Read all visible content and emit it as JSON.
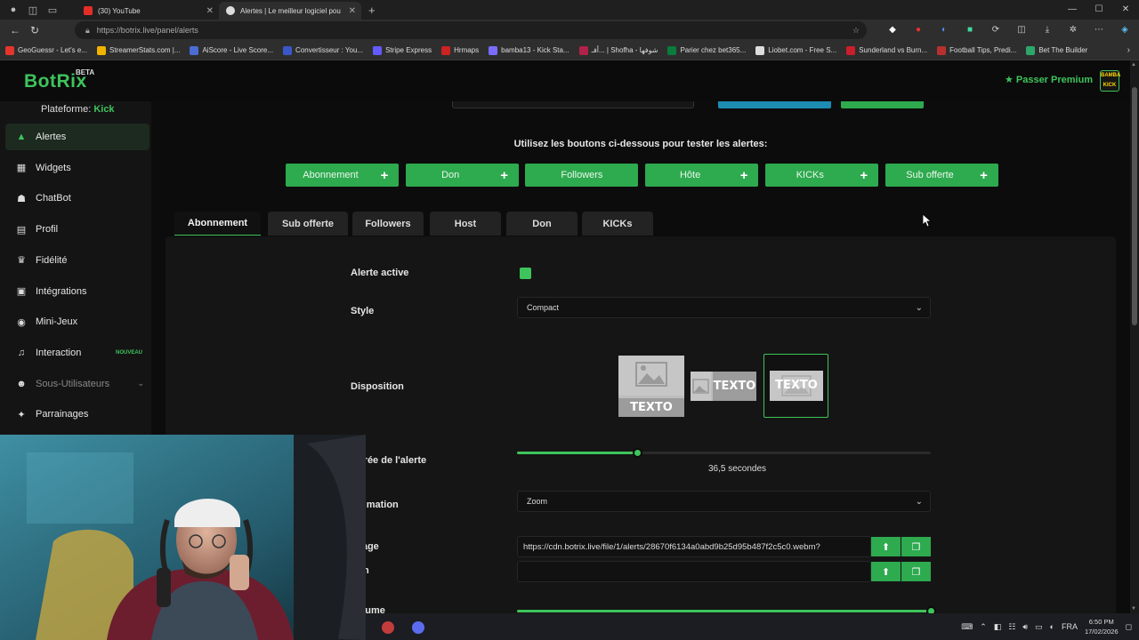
{
  "browser": {
    "tabs": [
      {
        "title": "(30) YouTube"
      },
      {
        "title": "Alertes | Le meilleur logiciel pou"
      }
    ],
    "url": "https://botrix.live/panel/alerts",
    "bookmarks": [
      {
        "label": "GeoGuessr - Let's e...",
        "color": "#e5352b"
      },
      {
        "label": "StreamerStats.com |...",
        "color": "#f0b400"
      },
      {
        "label": "AiScore - Live Score...",
        "color": "#4a6cd4"
      },
      {
        "label": "Convertisseur : You...",
        "color": "#3a57c8"
      },
      {
        "label": "Stripe Express",
        "color": "#635bff"
      },
      {
        "label": "Hrmaps",
        "color": "#cc2222"
      },
      {
        "label": "bamba13 - Kick Sta...",
        "color": "#7a6cff"
      },
      {
        "label": "أفـ... | Shofha - شوفها",
        "color": "#b1224a"
      },
      {
        "label": "Parier chez bet365...",
        "color": "#0b7a3b"
      },
      {
        "label": "Liobet.com - Free S...",
        "color": "#dddddd"
      },
      {
        "label": "Sunderland vs Burn...",
        "color": "#c81f2b"
      },
      {
        "label": "Football Tips, Predi...",
        "color": "#b5302f"
      },
      {
        "label": "Bet The Builder",
        "color": "#2ea66b"
      }
    ]
  },
  "app": {
    "logo": "BotRix",
    "beta": "BETA",
    "premium": "Passer Premium",
    "avatar_text": "BAMBA KICK",
    "accent": "#3ec45c"
  },
  "sidebar": {
    "platform_label": "Plateforme:",
    "platform_value": "Kick",
    "items": [
      {
        "label": "Alertes",
        "icon": "warning-icon",
        "glyph": "▲",
        "active": true
      },
      {
        "label": "Widgets",
        "icon": "grid-icon",
        "glyph": "▦"
      },
      {
        "label": "ChatBot",
        "icon": "robot-icon",
        "glyph": "☗"
      },
      {
        "label": "Profil",
        "icon": "id-card-icon",
        "glyph": "▤"
      },
      {
        "label": "Fidélité",
        "icon": "trophy-icon",
        "glyph": "♛"
      },
      {
        "label": "Intégrations",
        "icon": "server-icon",
        "glyph": "▣"
      },
      {
        "label": "Mini-Jeux",
        "icon": "gamepad-icon",
        "glyph": "◉"
      },
      {
        "label": "Interaction",
        "icon": "music-icon",
        "glyph": "♫",
        "badge": "NOUVEAU"
      },
      {
        "label": "Sous-Utilisateurs",
        "icon": "users-icon",
        "glyph": "☻",
        "dim": true
      },
      {
        "label": "Parrainages",
        "icon": "handshake-icon",
        "glyph": "✦"
      }
    ]
  },
  "main": {
    "hint": "Utilisez les boutons ci-dessous pour tester les alertes:",
    "test_buttons": [
      {
        "label": "Abonnement",
        "plus": true
      },
      {
        "label": "Don",
        "plus": true
      },
      {
        "label": "Followers",
        "plus": false
      },
      {
        "label": "Hôte",
        "plus": true
      },
      {
        "label": "KICKs",
        "plus": true
      },
      {
        "label": "Sub offerte",
        "plus": true
      }
    ],
    "tabs": [
      "Abonnement",
      "Sub offerte",
      "Followers",
      "Host",
      "Don",
      "KICKs"
    ],
    "active_tab": "Abonnement",
    "form": {
      "alert_active_label": "Alerte active",
      "alert_active": true,
      "style_label": "Style",
      "style_value": "Compact",
      "layout_label": "Disposition",
      "layout_text": "TEXTO",
      "layout_selected": 3,
      "duration_label": "Durée de l'alerte",
      "duration_fraction": 0.29,
      "duration_value": "36,5",
      "duration_unit": "secondes",
      "animation_label": "Animation",
      "animation_value": "Zoom",
      "image_label": "Image",
      "image_url": "https://cdn.botrix.live/file/1/alerts/28670f6134a0abd9b25d95b487f2c5c0.webm?",
      "sound_label": "Son",
      "sound_url": "",
      "volume_label": "Volume",
      "volume_fraction": 1.0
    }
  },
  "taskbar": {
    "lang": "FRA",
    "time": "6:50 PM",
    "date": "17/02/2026"
  }
}
